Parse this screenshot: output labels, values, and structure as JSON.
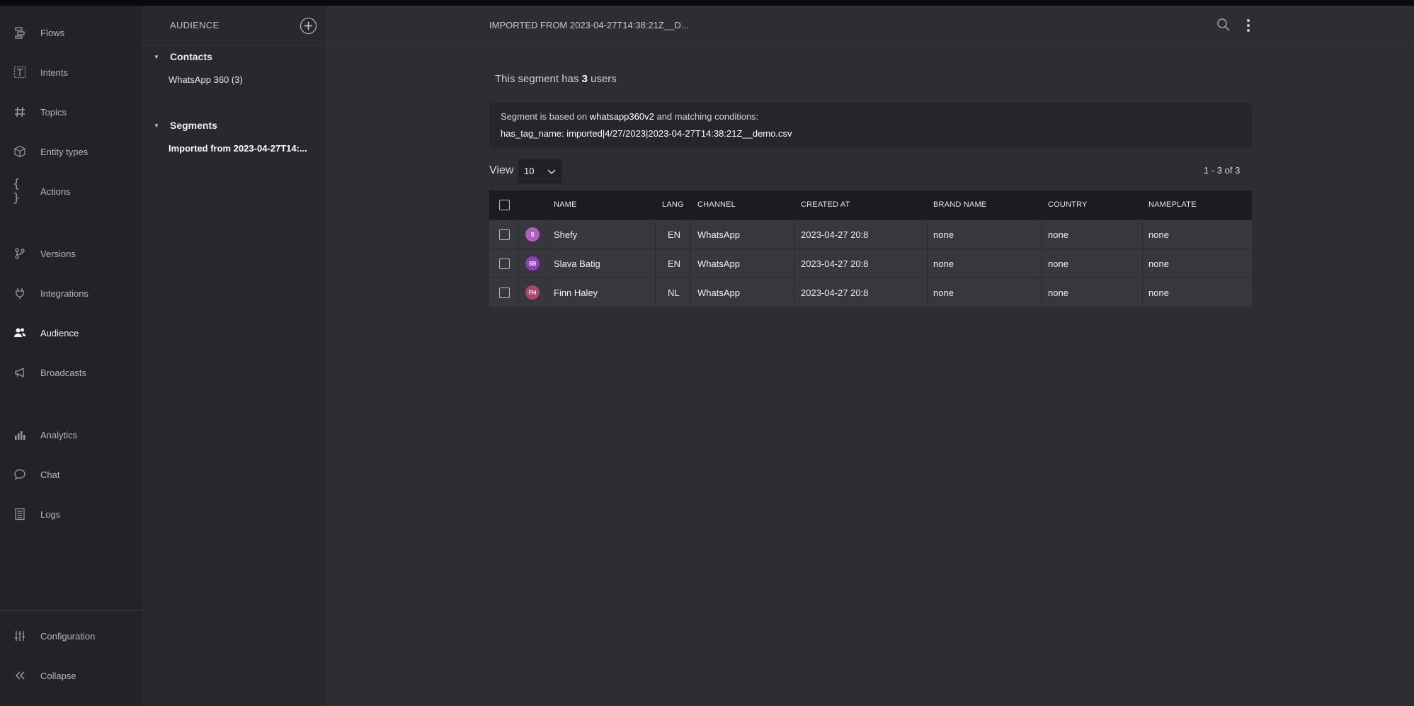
{
  "nav": {
    "items": [
      {
        "label": "Flows",
        "icon": "flows-icon"
      },
      {
        "label": "Intents",
        "icon": "text-t-icon"
      },
      {
        "label": "Topics",
        "icon": "hash-icon"
      },
      {
        "label": "Entity types",
        "icon": "cube-icon"
      },
      {
        "label": "Actions",
        "icon": "braces-icon"
      },
      {
        "label": "Versions",
        "icon": "branch-icon"
      },
      {
        "label": "Integrations",
        "icon": "plug-icon"
      },
      {
        "label": "Audience",
        "icon": "users-icon",
        "active": true
      },
      {
        "label": "Broadcasts",
        "icon": "megaphone-icon"
      },
      {
        "label": "Analytics",
        "icon": "bar-chart-icon"
      },
      {
        "label": "Chat",
        "icon": "chat-bubble-icon"
      },
      {
        "label": "Logs",
        "icon": "log-list-icon"
      }
    ],
    "bottom": [
      {
        "label": "Configuration",
        "icon": "sliders-icon"
      },
      {
        "label": "Collapse",
        "icon": "double-chevron-left-icon"
      }
    ]
  },
  "panel": {
    "title": "AUDIENCE",
    "contacts_title": "Contacts",
    "contacts_items": [
      "WhatsApp 360 (3)"
    ],
    "segments_title": "Segments",
    "segments_items": [
      "Imported from 2023-04-27T14:..."
    ]
  },
  "header": {
    "breadcrumb": "IMPORTED FROM 2023-04-27T14:38:21Z__D..."
  },
  "summary": {
    "prefix": "This segment has",
    "count": "3",
    "suffix": "users"
  },
  "condition": {
    "prefix": "Segment is based on",
    "source": "whatsapp360v2",
    "suffix": "and matching conditions:",
    "rule": "has_tag_name: imported|4/27/2023|2023-04-27T14:38:21Z__demo.csv"
  },
  "view": {
    "label": "View",
    "per_page": "10",
    "pager": "1 - 3 of 3"
  },
  "table": {
    "columns": [
      "NAME",
      "LANG",
      "CHANNEL",
      "CREATED AT",
      "BRAND NAME",
      "COUNTRY",
      "NAMEPLATE"
    ],
    "rows": [
      {
        "initials": "S",
        "avatar_color": "#b05fc0",
        "name": "Shefy",
        "lang": "EN",
        "channel": "WhatsApp",
        "created": "2023-04-27 20:8",
        "brand": "none",
        "country": "none",
        "nameplate": "none"
      },
      {
        "initials": "SB",
        "avatar_color": "#8e3fb8",
        "name": "Slava Batig",
        "lang": "EN",
        "channel": "WhatsApp",
        "created": "2023-04-27 20:8",
        "brand": "none",
        "country": "none",
        "nameplate": "none"
      },
      {
        "initials": "FH",
        "avatar_color": "#b0446a",
        "name": "Finn Haley",
        "lang": "NL",
        "channel": "WhatsApp",
        "created": "2023-04-27 20:8",
        "brand": "none",
        "country": "none",
        "nameplate": "none"
      }
    ]
  }
}
